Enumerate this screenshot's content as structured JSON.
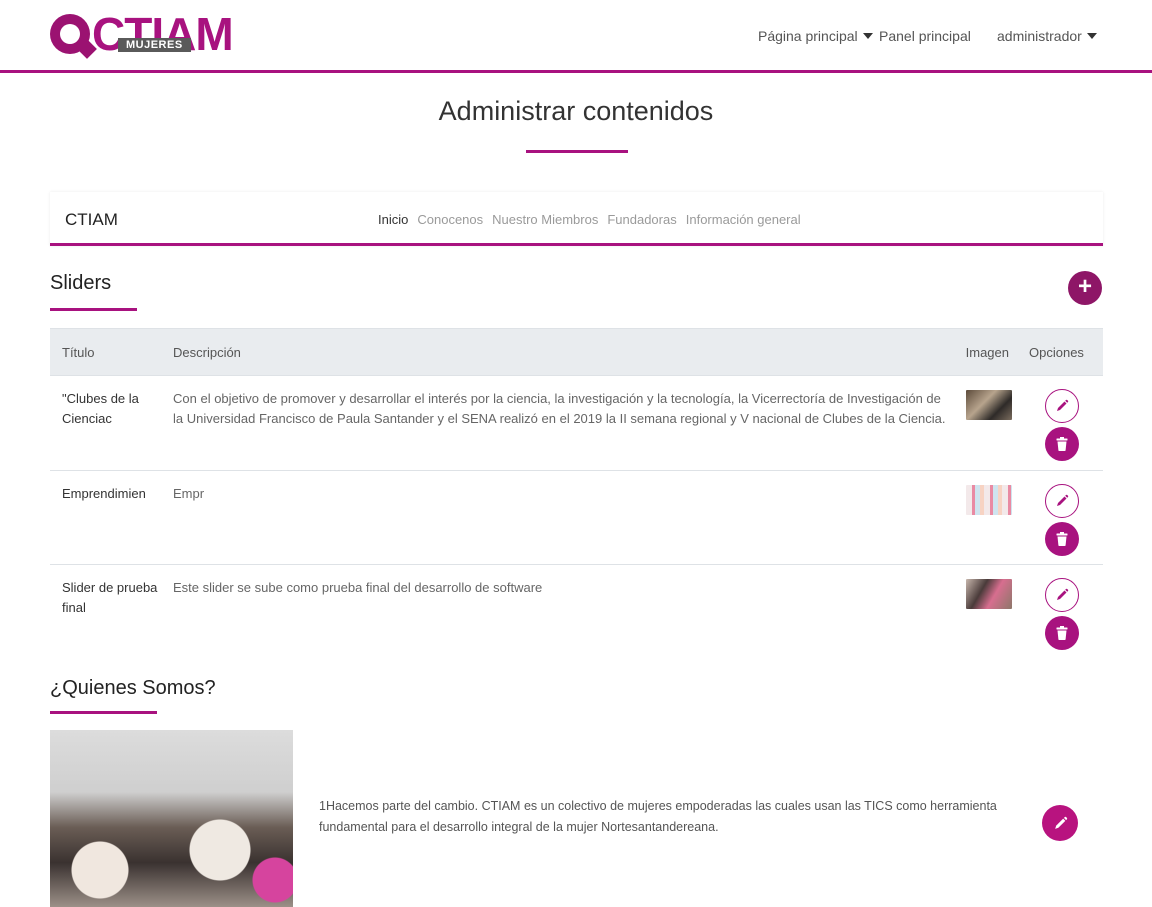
{
  "header": {
    "logo_text": "CTIAM",
    "logo_sub": "MUJERES",
    "nav": {
      "home_label": "Página principal",
      "panel_label": "Panel principal",
      "user_label": "administrador"
    }
  },
  "page": {
    "title": "Administrar contenidos"
  },
  "tabs_card": {
    "brand": "CTIAM",
    "tabs": [
      {
        "label": "Inicio",
        "active": true
      },
      {
        "label": "Conocenos",
        "active": false
      },
      {
        "label": "Nuestro Miembros",
        "active": false
      },
      {
        "label": "Fundadoras",
        "active": false
      },
      {
        "label": "Información general",
        "active": false
      }
    ]
  },
  "sliders": {
    "heading": "Sliders",
    "add_button_label": "+",
    "columns": [
      "Título",
      "Descripción",
      "Imagen",
      "Opciones"
    ],
    "rows": [
      {
        "title": "\"Clubes de la Cienciac",
        "description": "Con el objetivo de promover y desarrollar el interés por la ciencia, la investigación y la tecnología, la Vicerrectoría de Investigación de la Universidad Francisco de Paula Santander y el SENA realizó en el 2019 la II semana regional y V nacional de Clubes de la Ciencia."
      },
      {
        "title": "Emprendimien",
        "description": "Empr"
      },
      {
        "title": "Slider de prueba final",
        "description": "Este slider se sube como prueba final del desarrollo de software"
      }
    ]
  },
  "about": {
    "heading": "¿Quienes Somos?",
    "text": "1Hacemos parte del cambio. CTIAM es un colectivo de mujeres empoderadas las cuales usan las TICS como herramienta fundamental para el desarrollo integral de la mujer Nortesantandereana."
  },
  "colors": {
    "accent": "#a8127f",
    "accent_dark": "#8e1667",
    "table_header_bg": "#e9ecef"
  },
  "icons": {
    "edit": "pencil-icon",
    "delete": "trash-icon",
    "add": "plus-icon",
    "dropdown": "caret-down-icon"
  }
}
